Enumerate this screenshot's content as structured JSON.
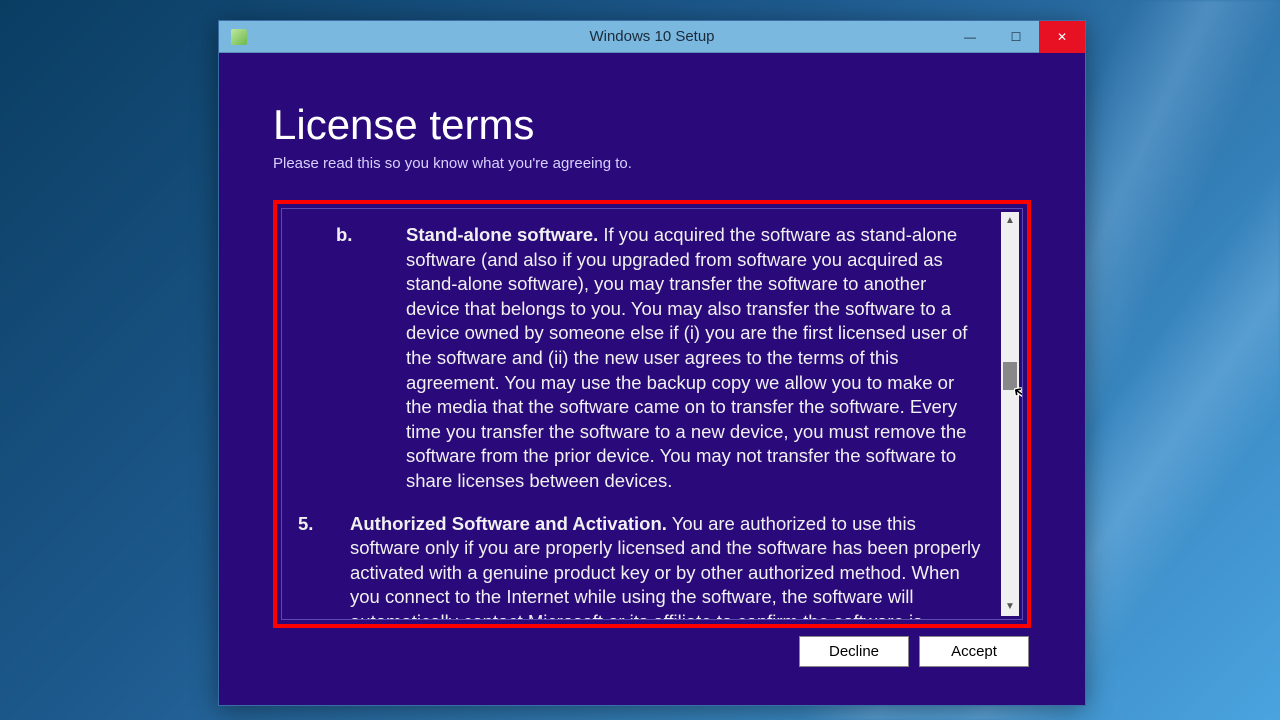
{
  "window": {
    "title": "Windows 10 Setup"
  },
  "page": {
    "heading": "License terms",
    "subheading": "Please read this so you know what you're agreeing to."
  },
  "license": {
    "items": [
      {
        "marker": "b.",
        "heading": "Stand-alone software.",
        "body": " If you acquired the software as stand-alone software (and also if you upgraded from software you acquired as stand-alone software), you may transfer the software to another device that belongs to you. You may also transfer the software to a device owned by someone else if (i) you are the first licensed user of the software and (ii) the new user agrees to the terms of this agreement. You may use the backup copy we allow you to make or the media that the software came on to transfer the software. Every time you transfer the software to a new device, you must remove the software from the prior device. You may not transfer the software to share licenses between devices."
      },
      {
        "marker": "5.",
        "heading": "Authorized Software and Activation.",
        "body": " You are authorized to use this software only if you are properly licensed and the software has been properly activated with a genuine product key or by other authorized method. When you connect to the Internet while using the software, the software will automatically contact Microsoft or its affiliate to confirm the software is genuine and the license is associated with the licensed device. You can also activate the software manually by Internet or"
      }
    ]
  },
  "buttons": {
    "decline": "Decline",
    "accept": "Accept"
  }
}
